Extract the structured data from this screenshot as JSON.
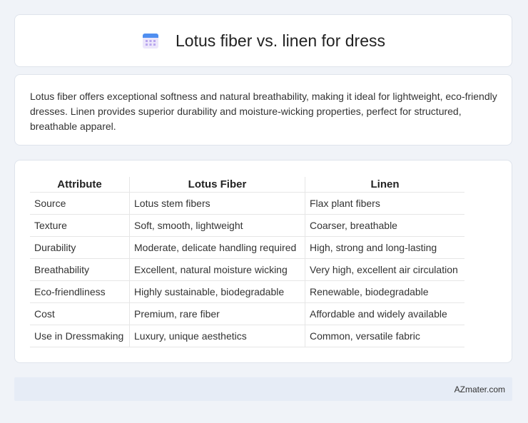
{
  "header": {
    "icon": "calendar-icon",
    "title": "Lotus fiber vs. linen for dress"
  },
  "summary": {
    "text": "Lotus fiber offers exceptional softness and natural breathability, making it ideal for lightweight, eco-friendly dresses. Linen provides superior durability and moisture-wicking properties, perfect for structured, breathable apparel."
  },
  "table": {
    "headers": [
      "Attribute",
      "Lotus Fiber",
      "Linen"
    ],
    "rows": [
      [
        "Source",
        "Lotus stem fibers",
        "Flax plant fibers"
      ],
      [
        "Texture",
        "Soft, smooth, lightweight",
        "Coarser, breathable"
      ],
      [
        "Durability",
        "Moderate, delicate handling required",
        "High, strong and long-lasting"
      ],
      [
        "Breathability",
        "Excellent, natural moisture wicking",
        "Very high, excellent air circulation"
      ],
      [
        "Eco-friendliness",
        "Highly sustainable, biodegradable",
        "Renewable, biodegradable"
      ],
      [
        "Cost",
        "Premium, rare fiber",
        "Affordable and widely available"
      ],
      [
        "Use in Dressmaking",
        "Luxury, unique aesthetics",
        "Common, versatile fabric"
      ]
    ]
  },
  "footer": {
    "brand": "AZmater.com"
  },
  "colors": {
    "background": "#f0f3f8",
    "card": "#ffffff",
    "footer": "#e6ecf6",
    "icon_top": "#5b8def",
    "icon_body": "#e9e3fb"
  }
}
